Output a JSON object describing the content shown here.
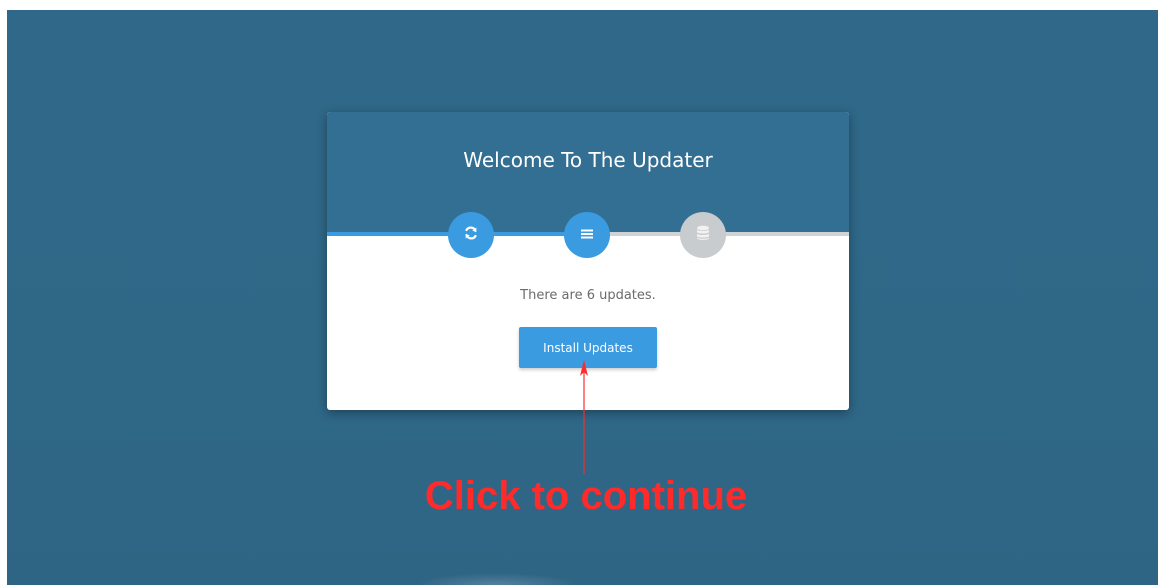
{
  "updater": {
    "title": "Welcome To The Updater",
    "status": "There are 6 updates.",
    "install_button_label": "Install Updates",
    "progress_fraction": 0.5,
    "steps": [
      {
        "icon": "refresh-icon",
        "state": "complete"
      },
      {
        "icon": "list-icon",
        "state": "current"
      },
      {
        "icon": "database-icon",
        "state": "pending"
      }
    ]
  },
  "annotation": {
    "text": "Click to continue",
    "color": "#ff2a2a"
  },
  "colors": {
    "background": "#2f6787",
    "header": "#336f93",
    "accent": "#3a9be0",
    "inactive_step": "#c9ccce"
  }
}
